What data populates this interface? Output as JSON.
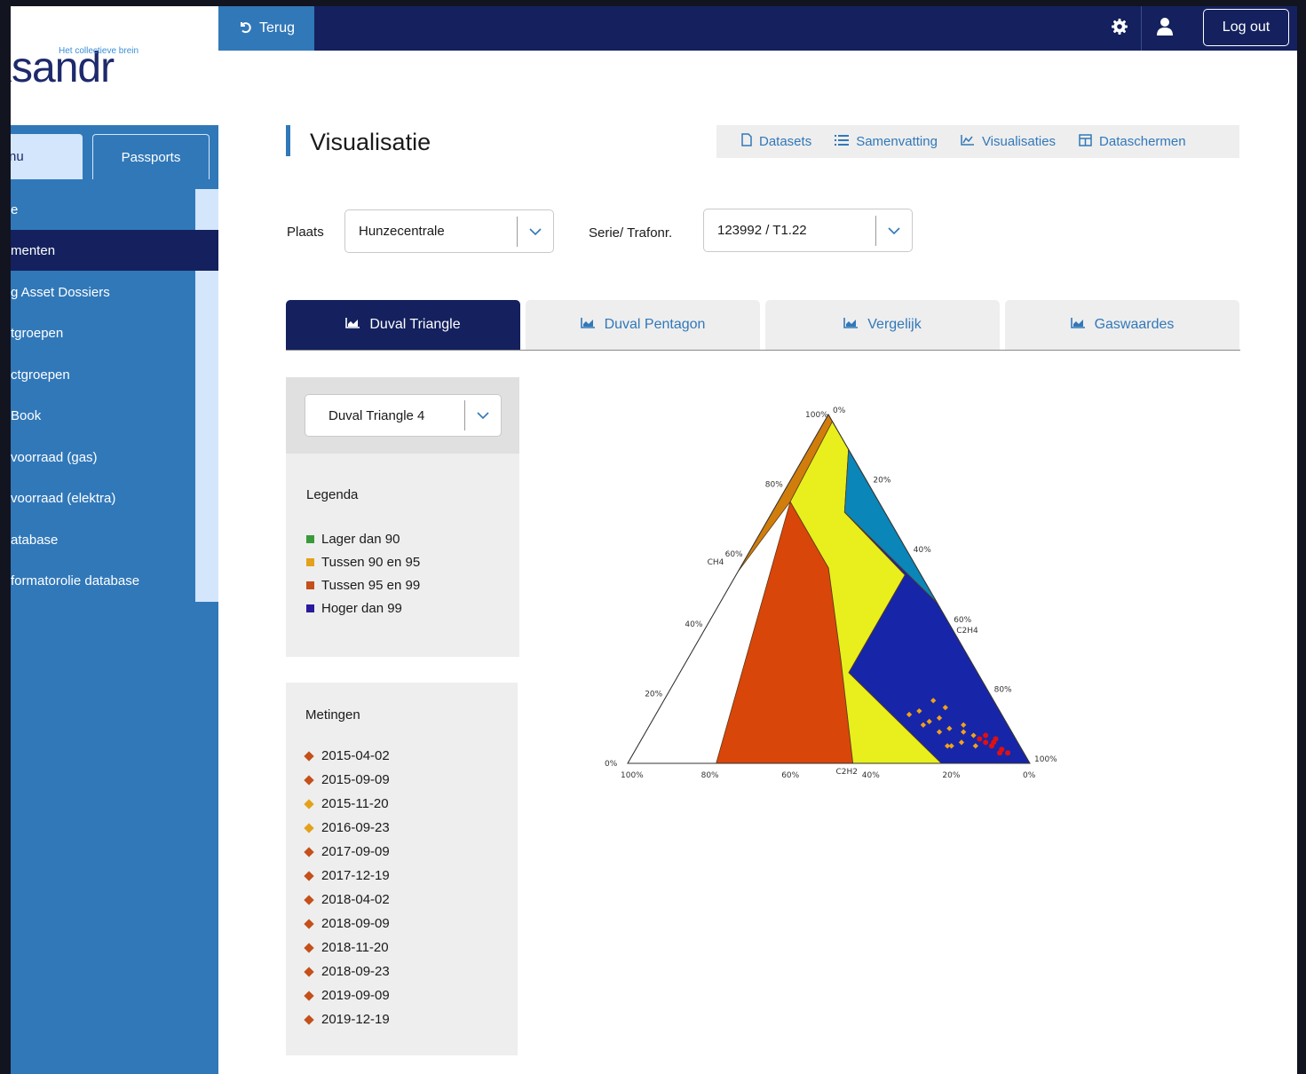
{
  "logo": {
    "text": "Ksandr",
    "tagline": "Het collectieve brein"
  },
  "sidebar": {
    "tabs": [
      {
        "label": "nu"
      },
      {
        "label": "Passports"
      }
    ],
    "items": [
      {
        "label": "e"
      },
      {
        "label": "menten",
        "active": true
      },
      {
        "label": "g Asset Dossiers"
      },
      {
        "label": "tgroepen"
      },
      {
        "label": "ctgroepen"
      },
      {
        "label": "Book"
      },
      {
        "label": "voorraad (gas)"
      },
      {
        "label": "voorraad (elektra)"
      },
      {
        "label": "atabase"
      },
      {
        "label": "formatorolie database"
      }
    ]
  },
  "topbar": {
    "back_label": "Terug",
    "logout_label": "Log out"
  },
  "page": {
    "title": "Visualisatie",
    "subnav": [
      {
        "label": "Datasets",
        "icon": "document-icon"
      },
      {
        "label": "Samenvatting",
        "icon": "list-icon"
      },
      {
        "label": "Visualisaties",
        "icon": "chart-icon"
      },
      {
        "label": "Dataschermen",
        "icon": "grid-icon"
      }
    ]
  },
  "filters": {
    "plaats_label": "Plaats",
    "plaats_value": "Hunzecentrale",
    "serie_label": "Serie/ Trafonr.",
    "serie_value": "123992 / T1.22"
  },
  "tabs": [
    {
      "label": "Duval Triangle",
      "active": true
    },
    {
      "label": "Duval Pentagon"
    },
    {
      "label": "Vergelijk"
    },
    {
      "label": "Gaswaardes"
    }
  ],
  "triangle_select": {
    "value": "Duval Triangle 4"
  },
  "legend": {
    "title": "Legenda",
    "items": [
      {
        "label": "Lager dan 90",
        "color": "#3a9a3a"
      },
      {
        "label": "Tussen 90 en 95",
        "color": "#e3a21a"
      },
      {
        "label": "Tussen 95 en 99",
        "color": "#c4501a"
      },
      {
        "label": "Hoger dan 99",
        "color": "#2a1a9e"
      }
    ]
  },
  "metingen": {
    "title": "Metingen",
    "items": [
      {
        "date": "2015-04-02",
        "color": "#c4501a"
      },
      {
        "date": "2015-09-09",
        "color": "#c4501a"
      },
      {
        "date": "2015-11-20",
        "color": "#e3a21a"
      },
      {
        "date": "2016-09-23",
        "color": "#e3a21a"
      },
      {
        "date": "2017-09-09",
        "color": "#c4501a"
      },
      {
        "date": "2017-12-19",
        "color": "#c4501a"
      },
      {
        "date": "2018-04-02",
        "color": "#c4501a"
      },
      {
        "date": "2018-09-09",
        "color": "#c4501a"
      },
      {
        "date": "2018-11-20",
        "color": "#c4501a"
      },
      {
        "date": "2018-09-23",
        "color": "#c4501a"
      },
      {
        "date": "2019-09-09",
        "color": "#c4501a"
      },
      {
        "date": "2019-12-19",
        "color": "#c4501a"
      }
    ]
  },
  "chart_data": {
    "type": "scatter",
    "axes": {
      "left": "CH4",
      "right": "C2H4",
      "bottom": "C2H2"
    },
    "tick_labels": [
      "0%",
      "20%",
      "40%",
      "60%",
      "80%",
      "100%"
    ],
    "zone_colors": [
      "#d07d0c",
      "#d9460a",
      "#e8ef1c",
      "#1726a8",
      "#0a86b8",
      "#9cf1f6",
      "#3aa03a"
    ],
    "points_orange": [
      [
        0.1,
        0.08
      ],
      [
        0.11,
        0.11
      ],
      [
        0.12,
        0.09
      ],
      [
        0.14,
        0.06
      ],
      [
        0.15,
        0.1
      ],
      [
        0.16,
        0.13
      ],
      [
        0.17,
        0.05
      ],
      [
        0.18,
        0.09
      ],
      [
        0.19,
        0.12
      ],
      [
        0.2,
        0.15
      ],
      [
        0.13,
        0.16
      ],
      [
        0.15,
        0.18
      ],
      [
        0.21,
        0.11
      ],
      [
        0.18,
        0.05
      ],
      [
        0.23,
        0.14
      ],
      [
        0.11,
        0.05
      ]
    ],
    "points_red": [
      [
        0.05,
        0.04
      ],
      [
        0.06,
        0.03
      ],
      [
        0.07,
        0.05
      ],
      [
        0.06,
        0.06
      ],
      [
        0.05,
        0.07
      ],
      [
        0.08,
        0.06
      ],
      [
        0.07,
        0.08
      ],
      [
        0.09,
        0.07
      ],
      [
        0.04,
        0.03
      ]
    ]
  }
}
